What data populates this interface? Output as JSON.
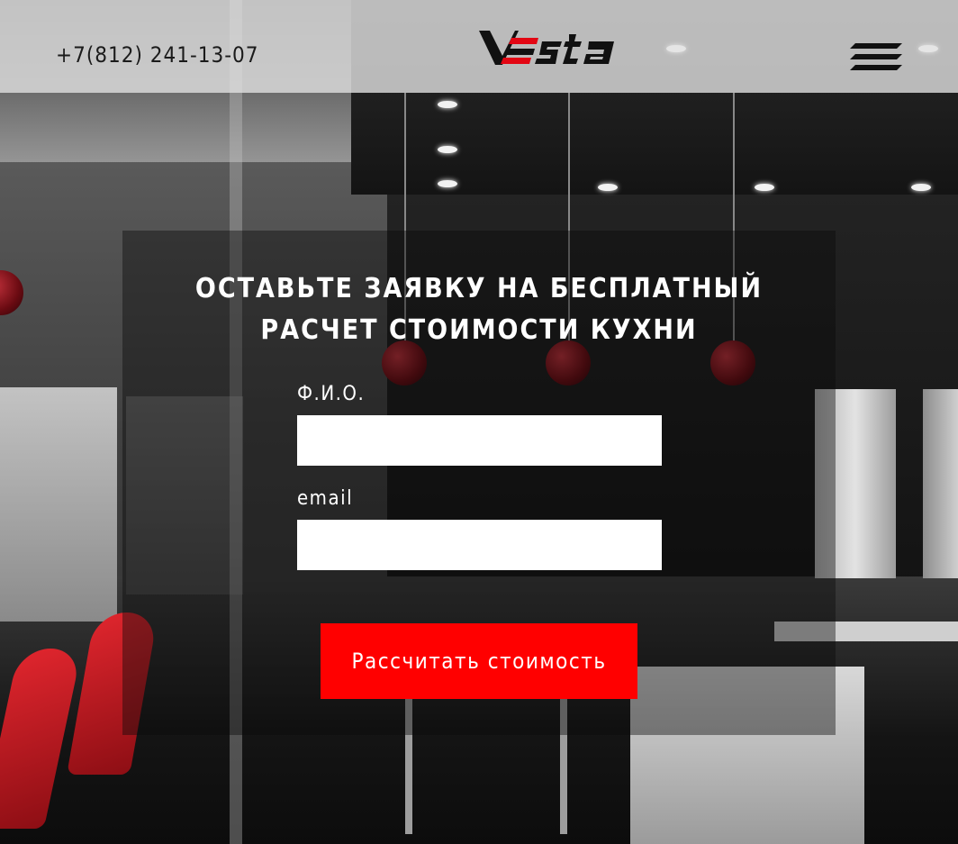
{
  "header": {
    "phone": "+7(812) 241-13-07",
    "logo_text": "VESTA",
    "menu_icon": "hamburger-menu-icon"
  },
  "form": {
    "title_line1": "ОСТАВЬТЕ ЗАЯВКУ НА БЕСПЛАТНЫЙ",
    "title_line2": "РАСЧЕТ СТОИМОСТИ КУХНИ",
    "name_label": "Ф.И.О.",
    "name_value": "",
    "email_label": "email",
    "email_value": "",
    "submit_label": "Рассчитать стоимость"
  },
  "colors": {
    "accent": "#ff0000",
    "header_bg": "#e1e1e1",
    "text_light": "#ffffff",
    "text_dark": "#1b1b1b"
  }
}
